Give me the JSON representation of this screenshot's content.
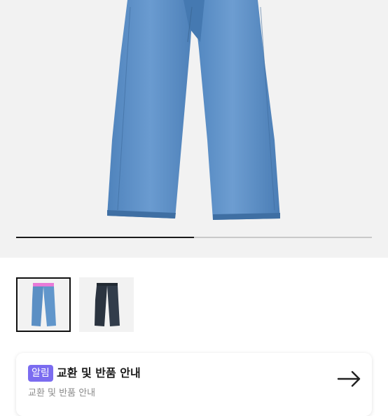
{
  "product": {
    "main_image_icon": "jeans-light-wash-icon",
    "gallery_progress": 0.5,
    "thumbnails": [
      {
        "icon": "jeans-light-wash-icon",
        "selected": true
      },
      {
        "icon": "jeans-dark-wash-icon",
        "selected": false
      }
    ]
  },
  "notice": {
    "badge": "알림",
    "title": "교환 및 반품 안내",
    "subtitle": "교환 및 반품 안내",
    "action_icon": "arrow-right-icon"
  },
  "colors": {
    "badge": "#7b6cf0",
    "light_denim": "#5b8fc4",
    "dark_denim": "#2b3440",
    "waistband": "#e87ad8"
  }
}
